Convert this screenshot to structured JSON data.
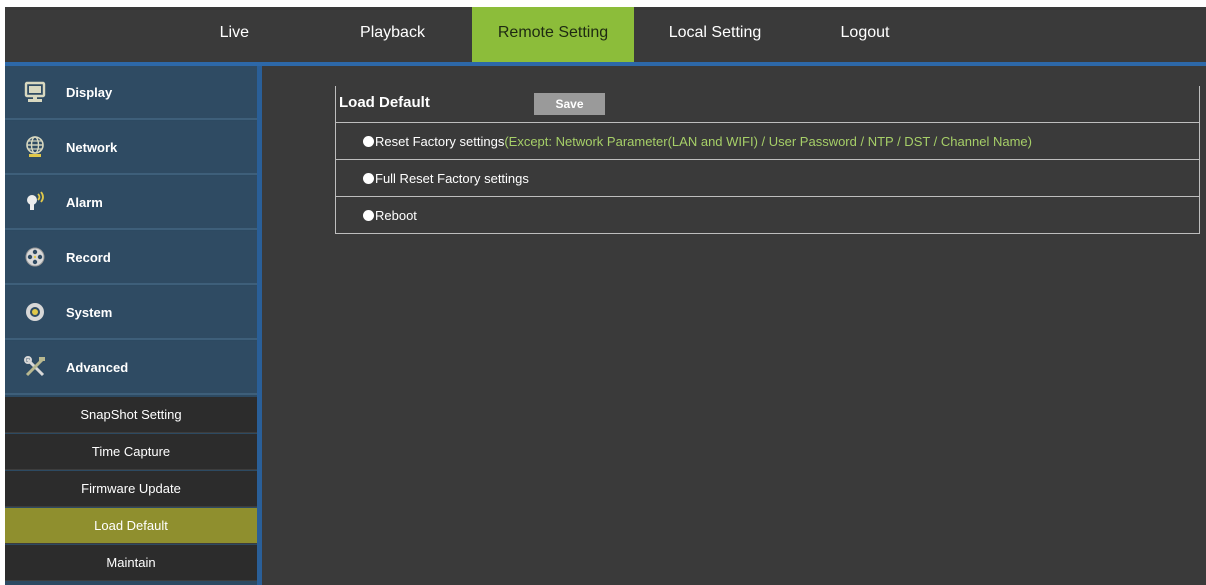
{
  "topnav": {
    "items": [
      {
        "label": "Live"
      },
      {
        "label": "Playback"
      },
      {
        "label": "Remote Setting",
        "active": true
      },
      {
        "label": "Local Setting"
      },
      {
        "label": "Logout"
      }
    ],
    "active_color": "#8cbd3a"
  },
  "sidebar": {
    "menu": [
      {
        "label": "Display",
        "icon": "monitor-icon"
      },
      {
        "label": "Network",
        "icon": "globe-icon"
      },
      {
        "label": "Alarm",
        "icon": "alarm-bulb-icon"
      },
      {
        "label": "Record",
        "icon": "film-reel-icon"
      },
      {
        "label": "System",
        "icon": "gear-icon"
      },
      {
        "label": "Advanced",
        "icon": "tools-icon"
      }
    ],
    "submenu": [
      {
        "label": "SnapShot Setting"
      },
      {
        "label": "Time Capture"
      },
      {
        "label": "Firmware Update"
      },
      {
        "label": "Load Default",
        "active": true
      },
      {
        "label": "Maintain"
      }
    ],
    "active_color": "#8f8f2e"
  },
  "panel": {
    "title": "Load Default",
    "save_label": "Save",
    "options": [
      {
        "label": "Reset Factory settings",
        "note": "(Except: Network Parameter(LAN and WIFI) / User Password / NTP / DST / Channel Name)"
      },
      {
        "label": "Full Reset Factory settings"
      },
      {
        "label": "Reboot"
      }
    ]
  }
}
